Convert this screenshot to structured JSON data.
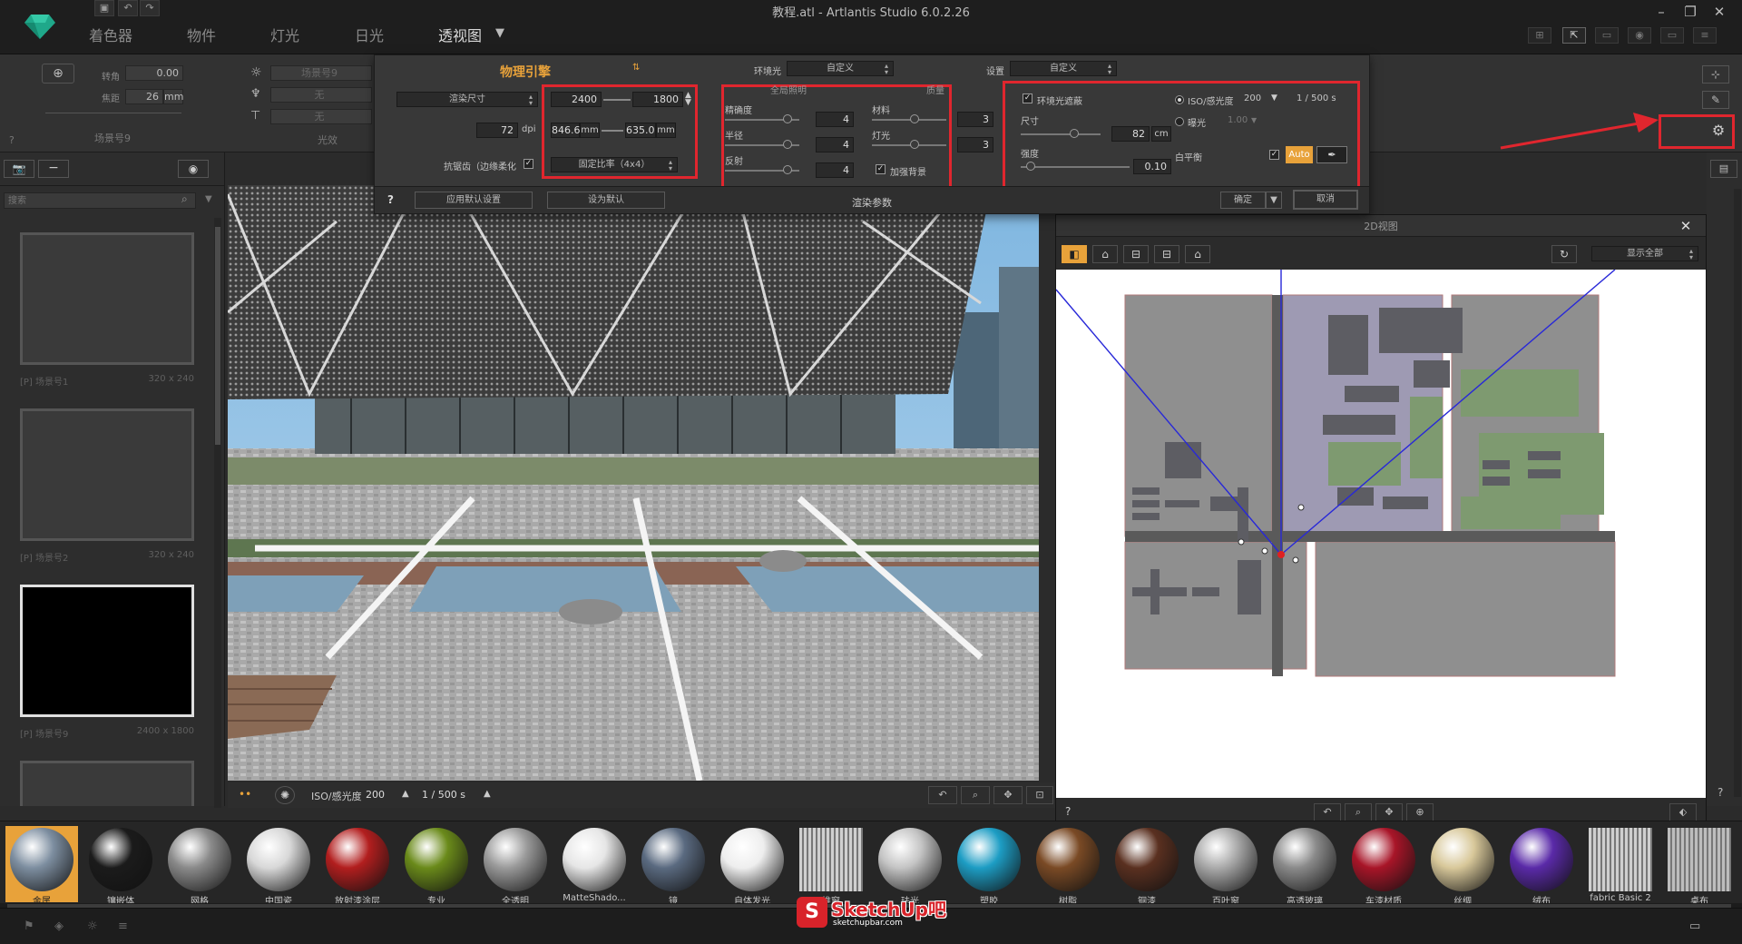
{
  "titlebar": {
    "title": "教程.atl - Artlantis Studio 6.0.2.26"
  },
  "main_tabs": [
    {
      "label": "着色器"
    },
    {
      "label": "物件"
    },
    {
      "label": "灯光"
    },
    {
      "label": "日光"
    },
    {
      "label": "透视图"
    }
  ],
  "strip": {
    "roll_label": "转角",
    "roll_value": "0.00",
    "focal_label": "焦距",
    "focal_value": "26",
    "focal_unit": "mm",
    "scene_name": "场景号9",
    "light_field_1": "场景号9",
    "light_field_2": "无",
    "light_field_3": "无",
    "light_sub": "光效",
    "help": "?"
  },
  "render_panel": {
    "engine": "物理引擎",
    "ambient_label": "环境光",
    "ambient_value": "自定义",
    "setting_label": "设置",
    "setting_value": "自定义",
    "render_size": "渲染尺寸",
    "width_px": "2400",
    "height_px": "1800",
    "dpi_value": "72",
    "dpi_unit": "dpi",
    "width_mm": "846.6",
    "height_mm": "635.0",
    "mm_unit": "mm",
    "antialias": "抗锯齿（边缘柔化",
    "ratio": "固定比率（4x4）",
    "global_light_header": "全局照明",
    "precision_label": "精确度",
    "precision_value": "4",
    "radius_label": "半径",
    "radius_value": "4",
    "bounce_label": "反射",
    "bounce_value": "4",
    "quality_header": "质量",
    "material_label": "材料",
    "material_value": "3",
    "lights_label": "灯光",
    "lights_value": "3",
    "add_bg": "加强背景",
    "ao_label": "环境光遮蔽",
    "size_label": "尺寸",
    "size_value": "82",
    "size_unit": "cm",
    "strength_label": "强度",
    "strength_value": "0.10",
    "iso_label": "ISO/感光度",
    "iso_value": "200",
    "shutter_value": "1 / 500 s",
    "exposure_label": "曝光",
    "exposure_value": "1.00",
    "wb_label": "白平衡",
    "wb_auto": "Auto",
    "help": "?",
    "apply_default": "应用默认设置",
    "set_default": "设为默认",
    "footer_title": "渲染参数",
    "ok": "确定",
    "cancel": "取消"
  },
  "left_panel": {
    "search_placeholder": "搜索",
    "thumbs": [
      {
        "caption": "[P] 场景号1",
        "size": "320 x 240"
      },
      {
        "caption": "[P] 场景号2",
        "size": "320 x 240"
      },
      {
        "caption": "[P] 场景号9",
        "size": "2400 x 1800"
      }
    ]
  },
  "viewport_bar": {
    "iso_label": "ISO/感光度",
    "iso_value": "200",
    "shutter": "1 / 500 s"
  },
  "view2d": {
    "title": "2D视图",
    "display_mode": "显示全部",
    "help": "?"
  },
  "materials": [
    {
      "label": "金属",
      "color": "#7d8ea0"
    },
    {
      "label": "镶嵌体",
      "color": "#1b1b1b"
    },
    {
      "label": "网格",
      "color": "#8a8a8a"
    },
    {
      "label": "中国瓷",
      "color": "#d8d8d8"
    },
    {
      "label": "放射漆涂层",
      "color": "#b21e1e"
    },
    {
      "label": "专业",
      "color": "#6a8a1a"
    },
    {
      "label": "全透明",
      "color": "#9a9a9a"
    },
    {
      "label": "MatteShado...",
      "color": "#e6e6e6"
    },
    {
      "label": "镜",
      "color": "#5a6a80"
    },
    {
      "label": "自体发光",
      "color": "#eeeeee"
    },
    {
      "label": "推窗",
      "color": "#d0d0d0"
    },
    {
      "label": "珐光",
      "color": "#c4c4c4"
    },
    {
      "label": "塑胶",
      "color": "#1d9dc4"
    },
    {
      "label": "树脂",
      "color": "#7a4a25"
    },
    {
      "label": "铜漆",
      "color": "#5a3020"
    },
    {
      "label": "百叶窗",
      "color": "#aaaaaa"
    },
    {
      "label": "高透玻璃",
      "color": "#8a8a8a"
    },
    {
      "label": "车漆材质",
      "color": "#a81528"
    },
    {
      "label": "丝绸",
      "color": "#d8c89a"
    },
    {
      "label": "绒布",
      "color": "#5a2aa8"
    },
    {
      "label": "fabric Basic 2",
      "color": "#cfcfcf"
    },
    {
      "label": "桌布",
      "color": "#bdbdbd"
    }
  ],
  "watermark": {
    "brand": "SketchUp吧",
    "url": "sketchupbar.com"
  }
}
